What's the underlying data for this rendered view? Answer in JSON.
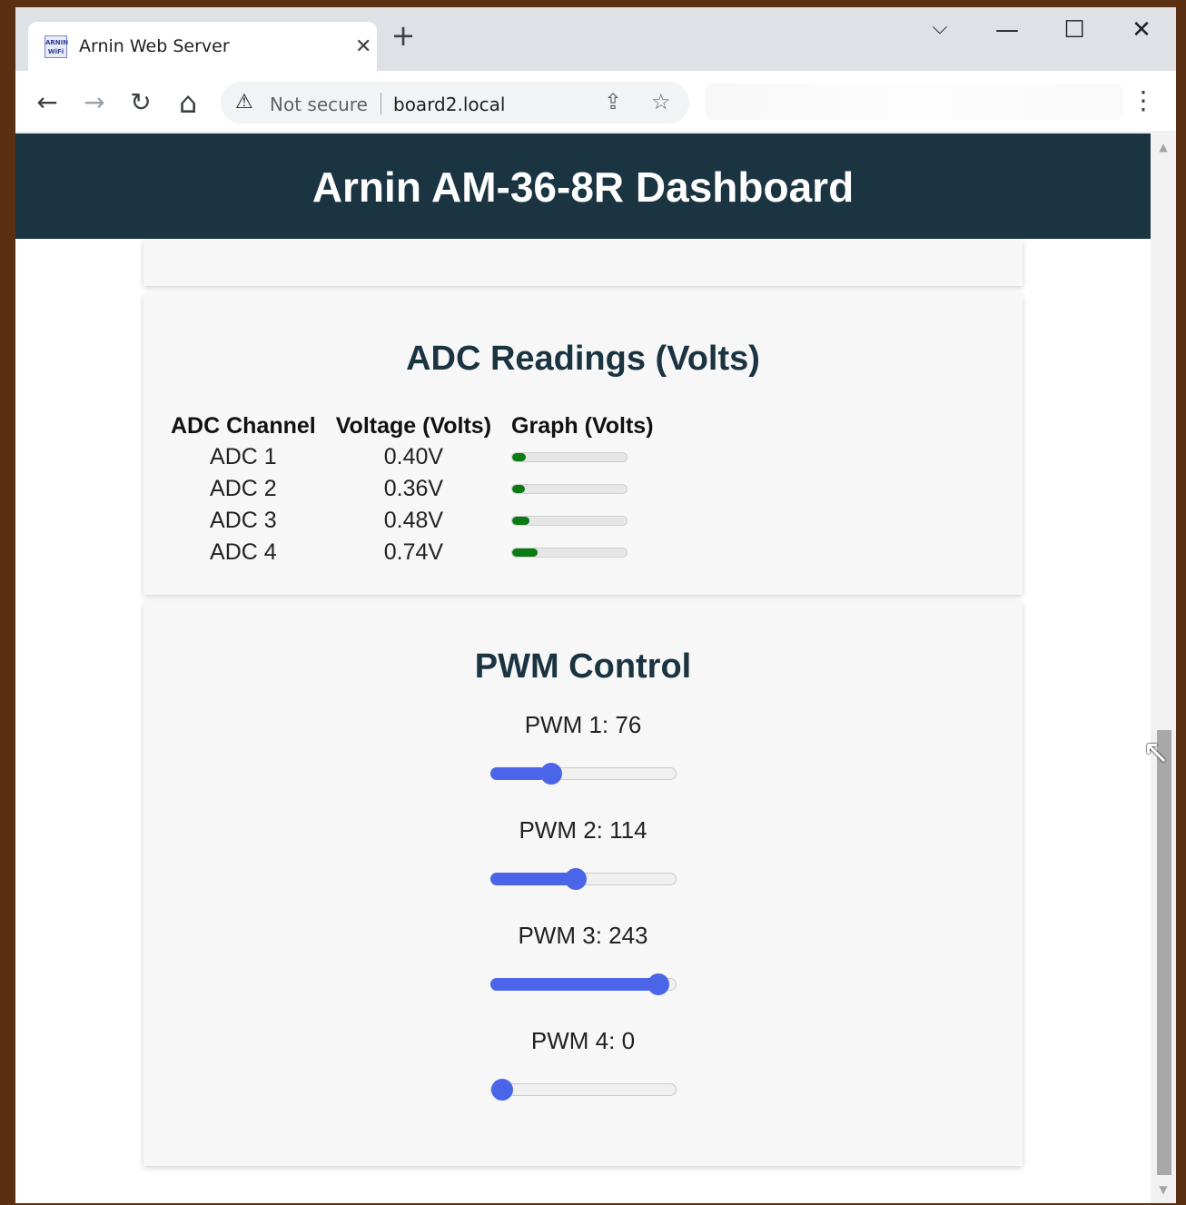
{
  "browser": {
    "tab_title": "Arnin Web Server",
    "favicon_text": "ARNIN WiFi",
    "tab_close": "✕",
    "new_tab": "+",
    "controls": {
      "dropdown": "⌵",
      "minimize": "—",
      "maximize": "☐",
      "close": "✕"
    },
    "nav": {
      "back": "←",
      "forward": "→",
      "reload": "↻",
      "home": "⌂"
    },
    "security_label": "Not secure",
    "url": "board2.local",
    "share_icon": "⇪",
    "bookmark_icon": "☆",
    "menu_icon": "⋮"
  },
  "page": {
    "title": "Arnin AM-36-8R Dashboard",
    "colors": {
      "header_bg": "#1b3442",
      "bar_fill": "#0a7a12",
      "slider": "#4a65e8"
    }
  },
  "adc": {
    "title": "ADC Readings (Volts)",
    "headers": [
      "ADC Channel",
      "Voltage (Volts)",
      "Graph (Volts)"
    ],
    "rows": [
      {
        "channel": "ADC 1",
        "voltage": "0.40V",
        "level": 0.12
      },
      {
        "channel": "ADC 2",
        "voltage": "0.36V",
        "level": 0.11
      },
      {
        "channel": "ADC 3",
        "voltage": "0.48V",
        "level": 0.15
      },
      {
        "channel": "ADC 4",
        "voltage": "0.74V",
        "level": 0.22
      }
    ]
  },
  "pwm": {
    "title": "PWM Control",
    "max": 255,
    "channels": [
      {
        "label": "PWM 1: 76",
        "value": 76
      },
      {
        "label": "PWM 2: 114",
        "value": 114
      },
      {
        "label": "PWM 3: 243",
        "value": 243
      },
      {
        "label": "PWM 4: 0",
        "value": 0
      }
    ]
  },
  "scrollbar": {
    "up": "▲",
    "down": "▼",
    "position": 0.56
  }
}
